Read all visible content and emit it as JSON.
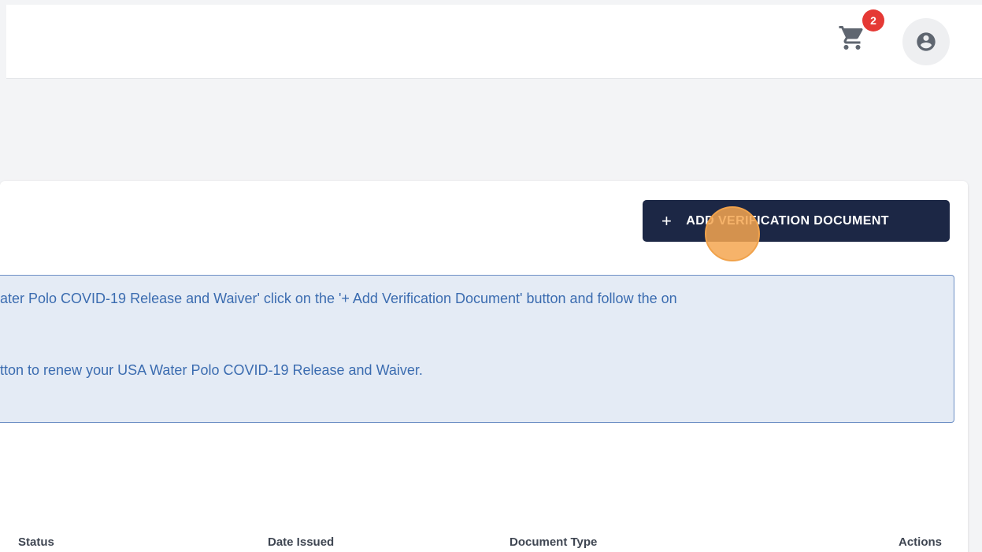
{
  "header": {
    "cart": {
      "icon": "cart-icon",
      "badge_count": "2"
    },
    "account": {
      "icon": "account-circle-icon"
    }
  },
  "card": {
    "add_button": {
      "icon": "plus-icon",
      "label": "ADD VERIFICATION DOCUMENT"
    },
    "notice": {
      "line1": "ater Polo COVID-19 Release and Waiver' click on the '+ Add Verification Document' button and follow the on",
      "line2": "tton to renew your USA Water Polo COVID-19 Release and Waiver."
    },
    "table": {
      "columns": [
        "Status",
        "Date Issued",
        "Document Type",
        "Actions"
      ]
    }
  },
  "colors": {
    "primary_button": "#1c2745",
    "badge": "#e53935",
    "notice_bg": "#e4ebf5",
    "notice_text": "#3b6cb0",
    "click_indicator": "#f5a650"
  }
}
